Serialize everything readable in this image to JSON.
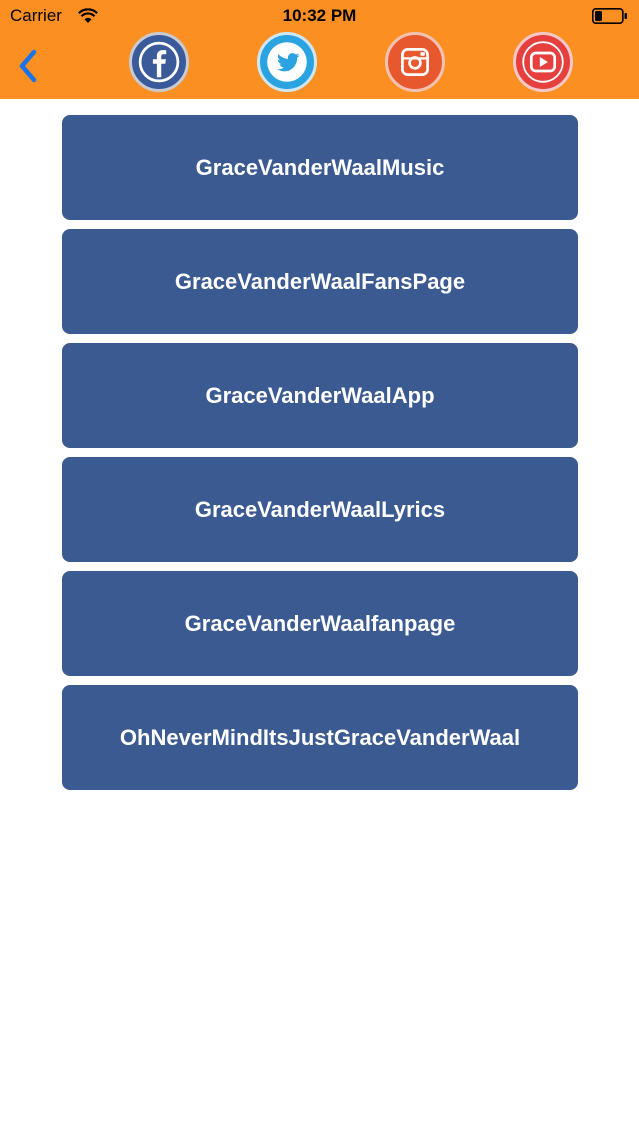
{
  "status_bar": {
    "carrier": "Carrier",
    "time": "10:32 PM"
  },
  "nav": {
    "back_icon": "chevron-left-icon",
    "social": [
      {
        "name": "facebook",
        "icon": "facebook-icon",
        "color": "#3b5a9a"
      },
      {
        "name": "twitter",
        "icon": "twitter-icon",
        "color": "#2aa3e0"
      },
      {
        "name": "instagram",
        "icon": "instagram-icon",
        "color": "#e8582f"
      },
      {
        "name": "youtube",
        "icon": "youtube-icon",
        "color": "#e5403e"
      }
    ],
    "bar_color": "#fc8f22"
  },
  "links": [
    "GraceVanderWaalMusic",
    "GraceVanderWaalFansPage",
    "GraceVanderWaalApp",
    "GraceVanderWaalLyrics",
    "GraceVanderWaalfanpage",
    "OhNeverMindItsJustGraceVanderWaal"
  ],
  "colors": {
    "button": "#3b5a91",
    "accent": "#1a73e8"
  }
}
